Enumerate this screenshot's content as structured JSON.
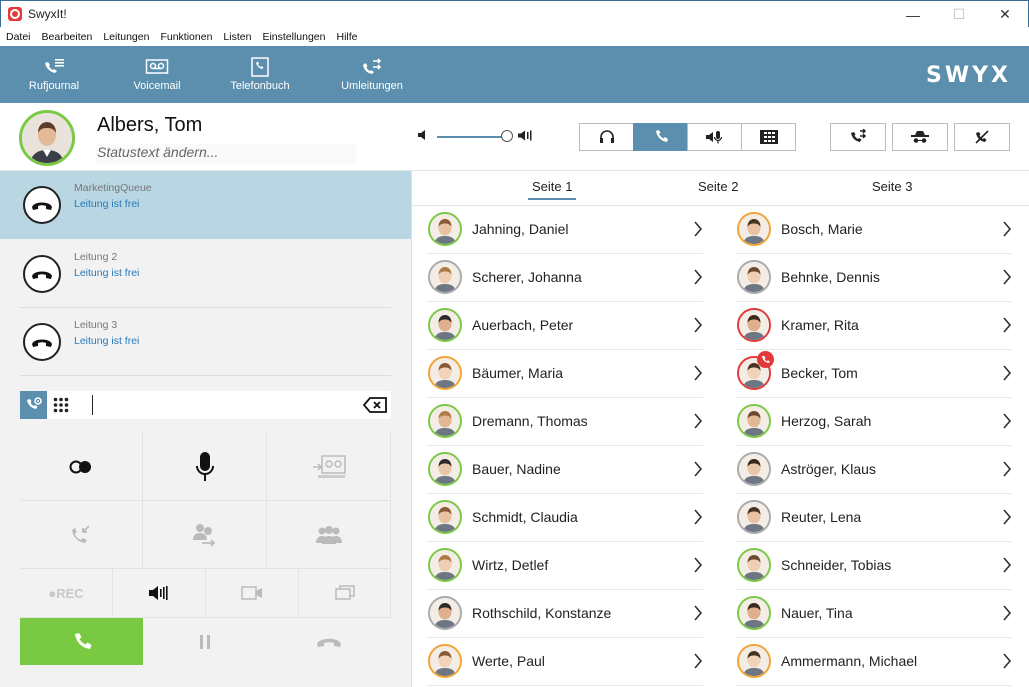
{
  "window": {
    "title": "SwyxIt!",
    "minimize": "—",
    "maximize": "☐",
    "close": "✕"
  },
  "menu": [
    "Datei",
    "Bearbeiten",
    "Leitungen",
    "Funktionen",
    "Listen",
    "Einstellungen",
    "Hilfe"
  ],
  "toolbar": {
    "items": [
      {
        "label": "Rufjournal",
        "icon": "call-journal-icon"
      },
      {
        "label": "Voicemail",
        "icon": "voicemail-icon"
      },
      {
        "label": "Telefonbuch",
        "icon": "phonebook-icon"
      },
      {
        "label": "Umleitungen",
        "icon": "redirect-icon"
      }
    ],
    "brand": "SWYX"
  },
  "user": {
    "name": "Albers, Tom",
    "status_placeholder": "Statustext ändern..."
  },
  "audio": {
    "volume_percent": 94
  },
  "modes": [
    {
      "icon": "headset-icon",
      "active": false
    },
    {
      "icon": "handset-icon",
      "active": true
    },
    {
      "icon": "speaker-mic-icon",
      "active": false
    },
    {
      "icon": "dialpad-mode-icon",
      "active": false
    }
  ],
  "actions": [
    {
      "icon": "call-forward-icon"
    },
    {
      "icon": "incognito-icon"
    },
    {
      "icon": "do-not-disturb-icon"
    }
  ],
  "lines": [
    {
      "name": "MarketingQueue",
      "status": "Leitung ist frei",
      "active": true
    },
    {
      "name": "Leitung 2",
      "status": "Leitung ist frei",
      "active": false
    },
    {
      "name": "Leitung 3",
      "status": "Leitung ist frei",
      "active": false
    }
  ],
  "dial": {
    "value": ""
  },
  "controls": {
    "rec_label": "●REC"
  },
  "tabs": [
    "Seite 1",
    "Seite 2",
    "Seite 3"
  ],
  "contacts_left": [
    {
      "name": "Jahning, Daniel",
      "status": "green"
    },
    {
      "name": "Scherer, Johanna",
      "status": "grey"
    },
    {
      "name": "Auerbach, Peter",
      "status": "green"
    },
    {
      "name": "Bäumer, Maria",
      "status": "orange"
    },
    {
      "name": "Dremann, Thomas",
      "status": "green"
    },
    {
      "name": "Bauer, Nadine",
      "status": "green"
    },
    {
      "name": "Schmidt, Claudia",
      "status": "green"
    },
    {
      "name": "Wirtz, Detlef",
      "status": "green"
    },
    {
      "name": "Rothschild, Konstanze",
      "status": "grey"
    },
    {
      "name": "Werte, Paul",
      "status": "orange"
    }
  ],
  "contacts_right": [
    {
      "name": "Bosch, Marie",
      "status": "orange"
    },
    {
      "name": "Behnke, Dennis",
      "status": "grey"
    },
    {
      "name": "Kramer, Rita",
      "status": "red"
    },
    {
      "name": "Becker, Tom",
      "status": "red",
      "calling": true
    },
    {
      "name": "Herzog, Sarah",
      "status": "green"
    },
    {
      "name": "Aströger, Klaus",
      "status": "grey"
    },
    {
      "name": "Reuter, Lena",
      "status": "none"
    },
    {
      "name": "Schneider, Tobias",
      "status": "green"
    },
    {
      "name": "Nauer, Tina",
      "status": "green"
    },
    {
      "name": "Ammermann, Michael",
      "status": "orange"
    }
  ]
}
